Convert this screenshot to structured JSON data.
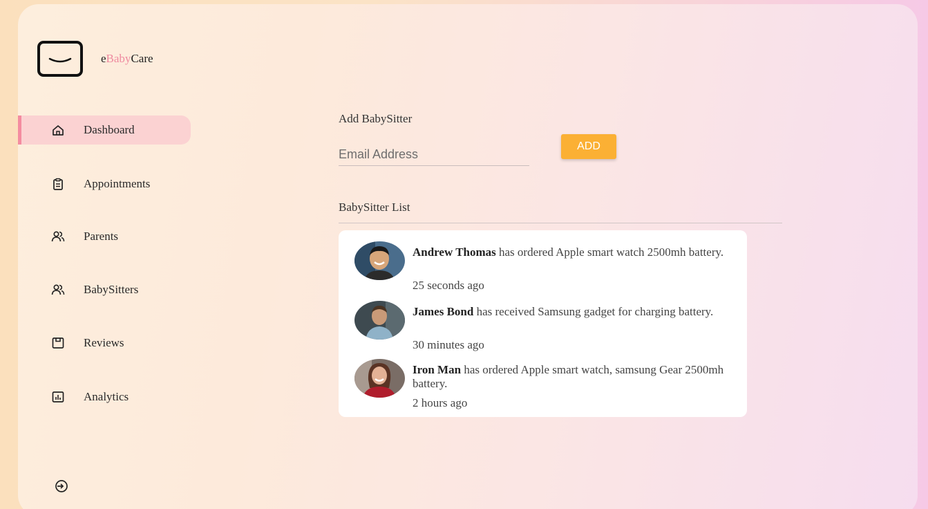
{
  "brand": {
    "prefix": "e",
    "highlight": "Baby",
    "suffix": "Care",
    "highlight_color": "#ef8aa0"
  },
  "sidebar": {
    "items": [
      {
        "label": "Dashboard",
        "icon": "home-icon",
        "active": true
      },
      {
        "label": "Appointments",
        "icon": "clipboard-icon",
        "active": false
      },
      {
        "label": "Parents",
        "icon": "users-icon",
        "active": false
      },
      {
        "label": "BabySitters",
        "icon": "users-icon",
        "active": false
      },
      {
        "label": "Reviews",
        "icon": "review-icon",
        "active": false
      },
      {
        "label": "Analytics",
        "icon": "chart-icon",
        "active": false
      }
    ],
    "logout_icon": "logout-icon"
  },
  "add_section": {
    "title": "Add BabySitter",
    "email_placeholder": "Email Address",
    "button_label": "ADD",
    "button_color": "#fbb034"
  },
  "list_section": {
    "title": "BabySitter List",
    "items": [
      {
        "name": "Andrew Thomas",
        "text": " has ordered Apple smart watch 2500mh battery.",
        "time": "25 seconds ago"
      },
      {
        "name": "James Bond",
        "text": " has received Samsung gadget for charging battery.",
        "time": "30 minutes ago"
      },
      {
        "name": "Iron Man",
        "text": " has ordered Apple smart watch, samsung Gear 2500mh battery.",
        "time": "2 hours ago"
      }
    ]
  }
}
